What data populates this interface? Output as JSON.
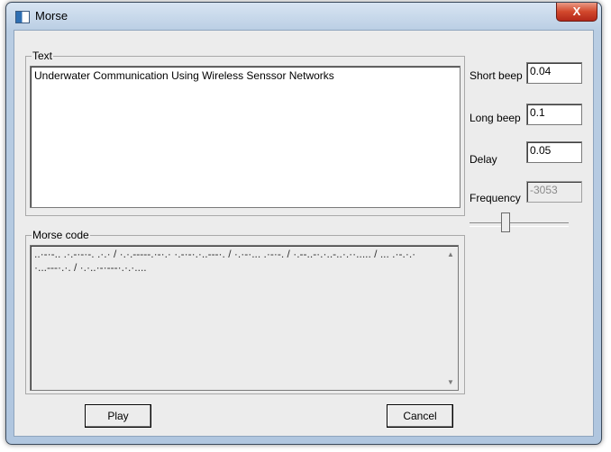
{
  "window": {
    "title": "Morse"
  },
  "text_group": {
    "title": "Text",
    "value": "Underwater Communication Using Wireless Senssor Networks"
  },
  "morse_group": {
    "title": "Morse code",
    "value": "..·-·-.. .·.-·-·-. .·.· / ·.·.-----.·-·.· ·.-·-·.·..---·. / ·.·-·... .·-·-. / ·.--..-·.·..-..·.··..... / ... .·-.·.··...---·.·. / ·.·..·-·---·.·.·....",
    "scroll_up": "▲",
    "scroll_down": "▼"
  },
  "settings": {
    "short_beep": {
      "label": "Short beep",
      "value": "0.04"
    },
    "long_beep": {
      "label": "Long beep",
      "value": "0.1"
    },
    "delay": {
      "label": "Delay",
      "value": "0.05"
    },
    "frequency": {
      "label": "Frequency",
      "value": "-3053"
    }
  },
  "buttons": {
    "play": "Play",
    "cancel": "Cancel",
    "close": "X"
  }
}
